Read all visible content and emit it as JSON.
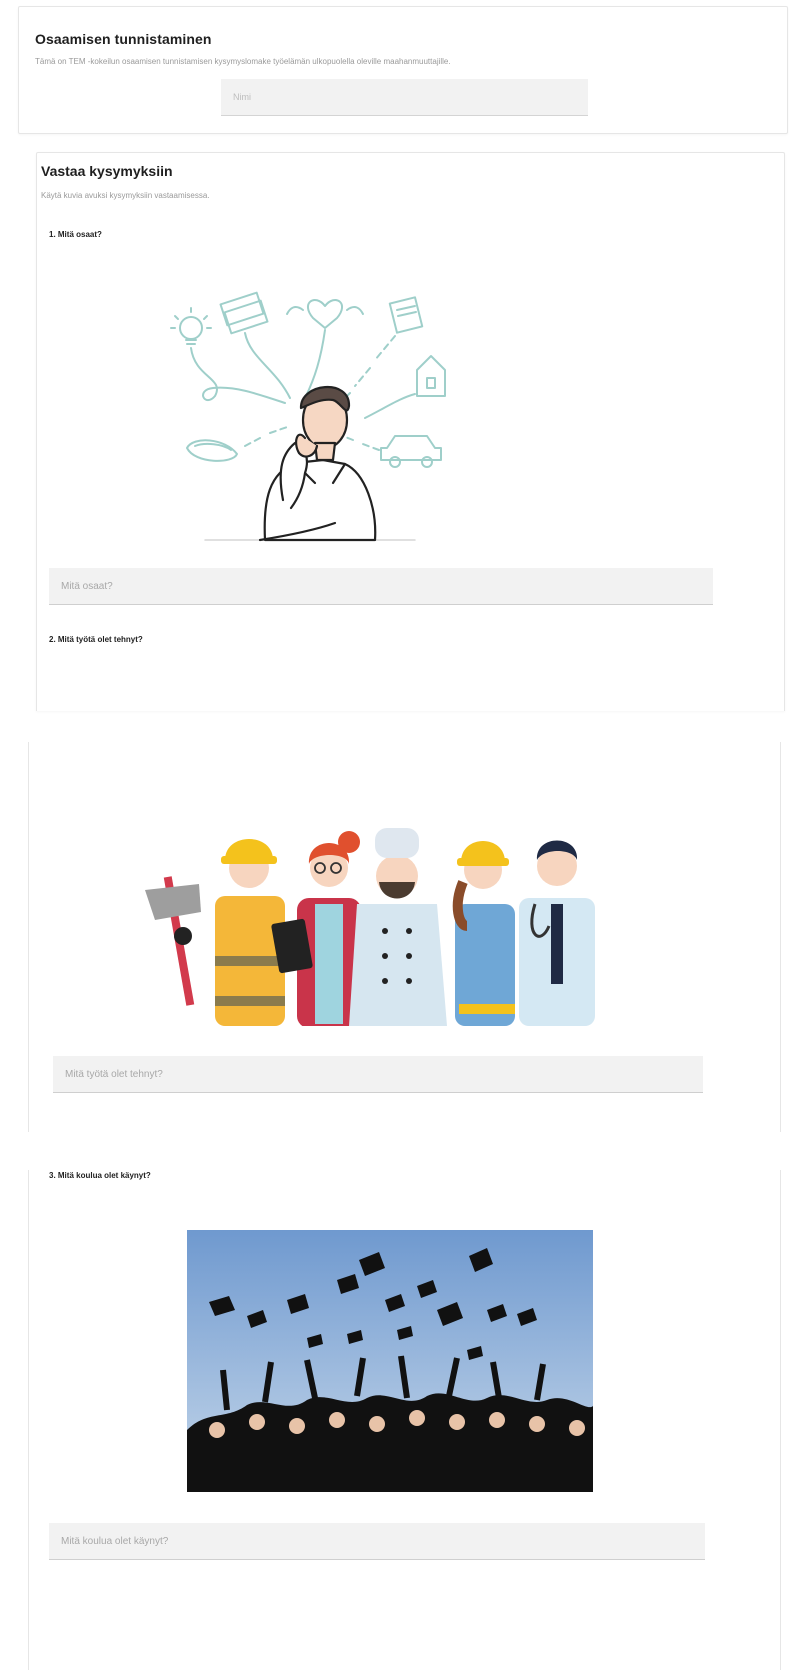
{
  "form": {
    "title": "Osaamisen tunnistaminen",
    "description": "Tämä on TEM -kokeilun osaamisen tunnistamisen kysymyslomake työelämän ulkopuolella oleville maahanmuuttajille.",
    "name_placeholder": "Nimi"
  },
  "section": {
    "title": "Vastaa kysymyksiin",
    "description": "Käytä kuvia avuksi kysymyksiin vastaamisessa."
  },
  "questions": [
    {
      "label": "1. Mitä osaat?",
      "placeholder": "Mitä osaat?",
      "image": "thinking-person-illustration"
    },
    {
      "label": "2. Mitä työtä olet tehnyt?",
      "placeholder": "Mitä työtä olet tehnyt?",
      "image": "workers-illustration"
    },
    {
      "label": "3. Mitä koulua olet käynyt?",
      "placeholder": "Mitä koulua olet käynyt?",
      "image": "graduation-photo"
    }
  ],
  "colors": {
    "line_art": "#9fcfca",
    "field_bg": "#f2f2f2",
    "helmet": "#f4c21c",
    "sky_top": "#6f99cf",
    "sky_bottom": "#c5d7ea"
  }
}
